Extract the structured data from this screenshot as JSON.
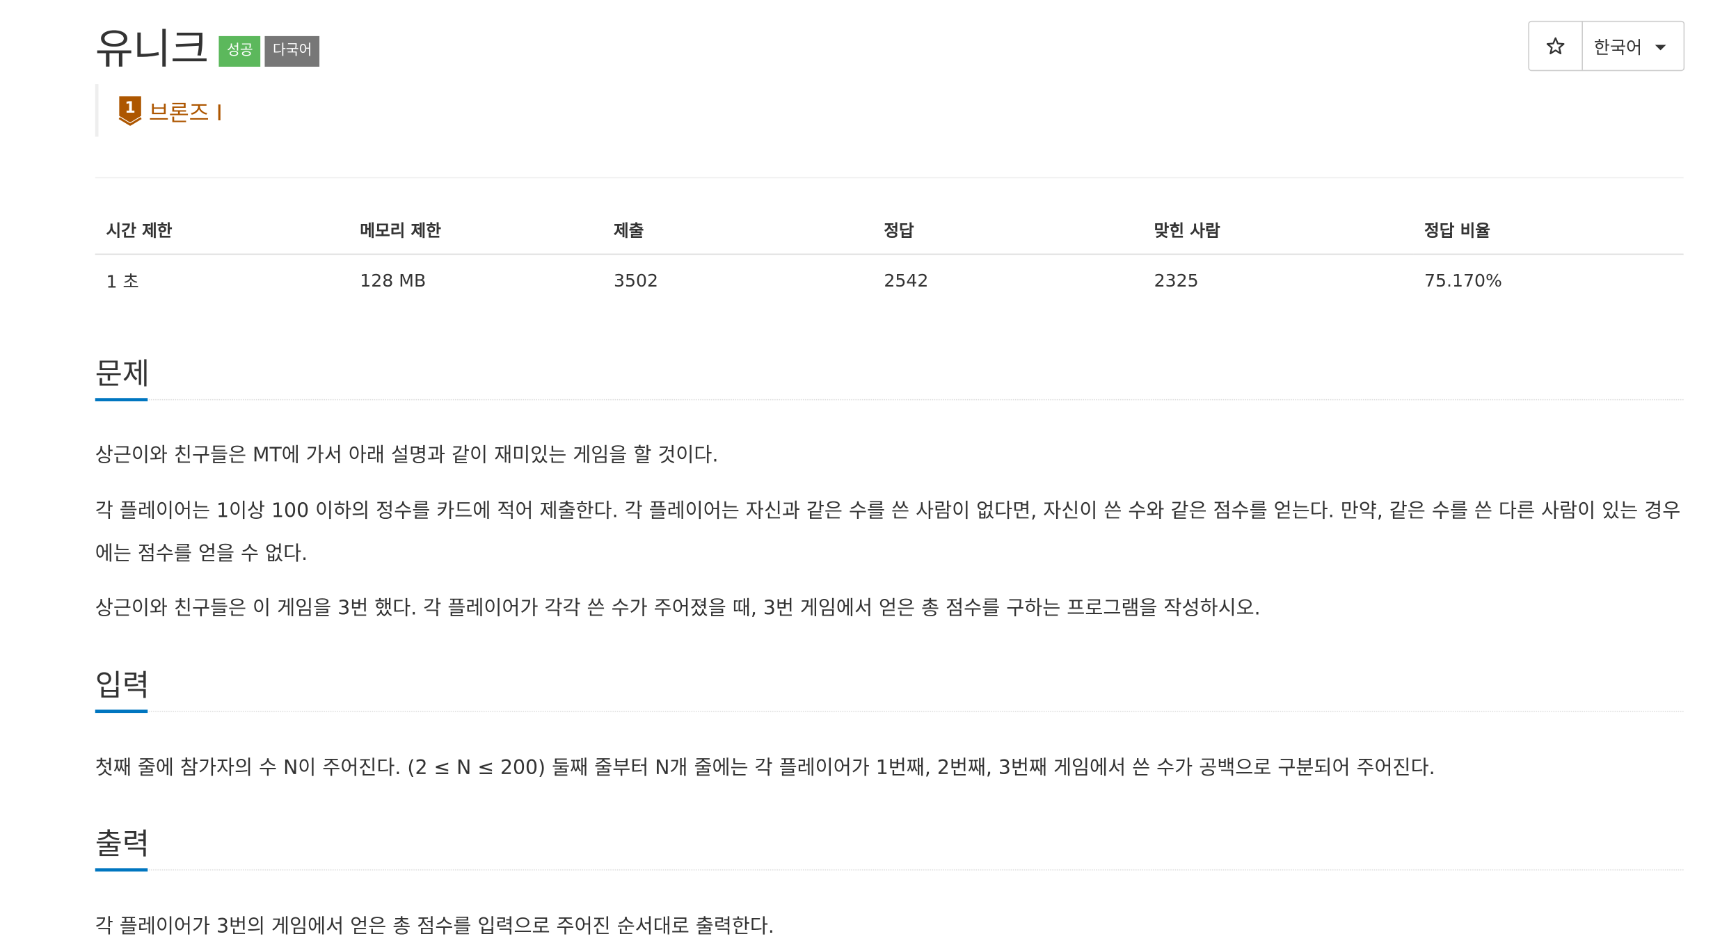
{
  "header": {
    "title": "유니크",
    "badges": {
      "success": "성공",
      "multilang": "다국어"
    },
    "tier": {
      "number": "1",
      "label": "브론즈 I",
      "color": "#ad5600"
    },
    "star_icon": "star-outline-icon",
    "language_select": "한국어"
  },
  "info_table": {
    "headers": [
      "시간 제한",
      "메모리 제한",
      "제출",
      "정답",
      "맞힌 사람",
      "정답 비율"
    ],
    "values": [
      "1 초",
      "128 MB",
      "3502",
      "2542",
      "2325",
      "75.170%"
    ]
  },
  "sections": {
    "problem": {
      "title": "문제",
      "paragraphs": [
        "상근이와 친구들은 MT에 가서 아래 설명과 같이 재미있는 게임을 할 것이다.",
        "각 플레이어는 1이상 100 이하의 정수를 카드에 적어 제출한다. 각 플레이어는 자신과 같은 수를 쓴 사람이 없다면, 자신이 쓴 수와 같은 점수를 얻는다. 만약, 같은 수를 쓴 다른 사람이 있는 경우에는 점수를 얻을 수 없다.",
        "상근이와 친구들은 이 게임을 3번 했다. 각 플레이어가 각각 쓴 수가 주어졌을 때, 3번 게임에서 얻은 총 점수를 구하는 프로그램을 작성하시오."
      ]
    },
    "input": {
      "title": "입력",
      "paragraphs": [
        "첫째 줄에 참가자의 수 N이 주어진다. (2 ≤ N ≤ 200) 둘째 줄부터 N개 줄에는 각 플레이어가 1번째, 2번째, 3번째 게임에서 쓴 수가 공백으로 구분되어 주어진다."
      ]
    },
    "output": {
      "title": "출력",
      "paragraphs": [
        "각 플레이어가 3번의 게임에서 얻은 총 점수를 입력으로 주어진 순서대로 출력한다."
      ]
    }
  },
  "colors": {
    "success": "#5cb85c",
    "multilang": "#777777",
    "accent": "#0076c0",
    "bronze": "#ad5600"
  }
}
